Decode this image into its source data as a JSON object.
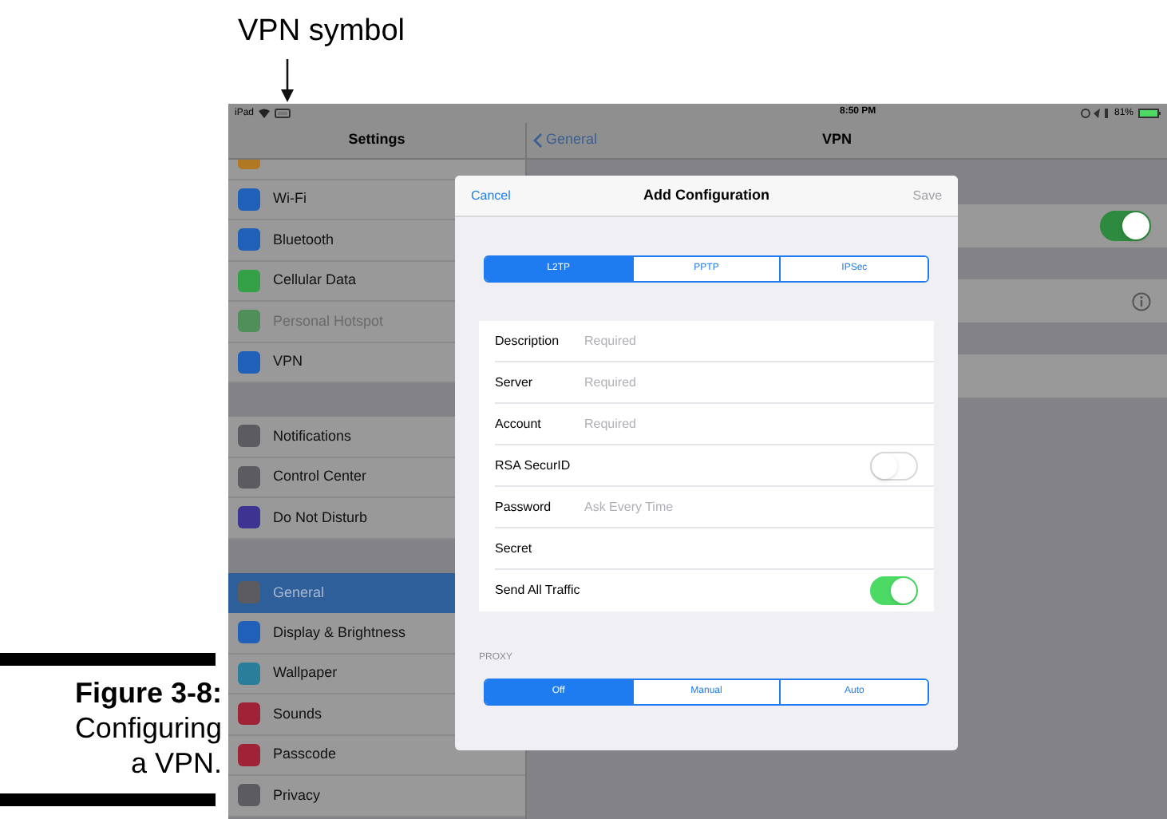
{
  "annotation": {
    "label": "VPN symbol"
  },
  "caption": {
    "figure": "Figure 3-8:",
    "text": "Configuring a VPN."
  },
  "status_bar": {
    "device": "iPad",
    "time": "8:50 PM",
    "battery": "81%"
  },
  "sidebar": {
    "title": "Settings",
    "groups": [
      [
        {
          "color": "#b07820"
        },
        {
          "label": "Wi-Fi",
          "color": "#2060b8",
          "selected": false,
          "disabled": false
        },
        {
          "label": "Bluetooth",
          "color": "#2060b8",
          "selected": false,
          "disabled": false
        },
        {
          "label": "Cellular Data",
          "color": "#34a048",
          "selected": false,
          "disabled": false
        },
        {
          "label": "Personal Hotspot",
          "color": "#4f8f5a",
          "selected": false,
          "disabled": true
        },
        {
          "label": "VPN",
          "color": "#2060b8",
          "selected": false,
          "disabled": false
        }
      ],
      [
        {
          "label": "Notifications",
          "color": "#5c5c60",
          "selected": false,
          "disabled": false
        },
        {
          "label": "Control Center",
          "color": "#5c5c60",
          "selected": false,
          "disabled": false
        },
        {
          "label": "Do Not Disturb",
          "color": "#3c3490",
          "selected": false,
          "disabled": false
        }
      ],
      [
        {
          "label": "General",
          "color": "#5c5c60",
          "selected": true,
          "disabled": false
        },
        {
          "label": "Display & Brightness",
          "color": "#2060b8",
          "selected": false,
          "disabled": false
        },
        {
          "label": "Wallpaper",
          "color": "#2a7e9a",
          "selected": false,
          "disabled": false
        },
        {
          "label": "Sounds",
          "color": "#a02236",
          "selected": false,
          "disabled": false
        },
        {
          "label": "Passcode",
          "color": "#a02236",
          "selected": false,
          "disabled": false
        },
        {
          "label": "Privacy",
          "color": "#5c5c60",
          "selected": false,
          "disabled": false
        }
      ]
    ]
  },
  "detail": {
    "back": "General",
    "title": "VPN",
    "rows": [
      {
        "kind": "toggle",
        "on": true
      },
      {
        "kind": "info"
      },
      {
        "kind": "blank"
      }
    ]
  },
  "dialog": {
    "cancel": "Cancel",
    "title": "Add Configuration",
    "save": {
      "label": "Save",
      "disabled": true
    },
    "types": [
      {
        "label": "L2TP",
        "selected": true
      },
      {
        "label": "PPTP",
        "selected": false
      },
      {
        "label": "IPSec",
        "selected": false
      }
    ],
    "fields": [
      {
        "kind": "text",
        "label": "Description",
        "placeholder": "Required"
      },
      {
        "kind": "text",
        "label": "Server",
        "placeholder": "Required"
      },
      {
        "kind": "text",
        "label": "Account",
        "placeholder": "Required"
      },
      {
        "kind": "toggle",
        "label": "RSA SecurID",
        "on": false
      },
      {
        "kind": "text",
        "label": "Password",
        "placeholder": "Ask Every Time"
      },
      {
        "kind": "text",
        "label": "Secret"
      },
      {
        "kind": "toggle",
        "label": "Send All Traffic",
        "on": true
      }
    ],
    "proxy": {
      "label": "PROXY",
      "options": [
        {
          "label": "Off",
          "selected": true
        },
        {
          "label": "Manual",
          "selected": false
        },
        {
          "label": "Auto",
          "selected": false
        }
      ]
    }
  }
}
